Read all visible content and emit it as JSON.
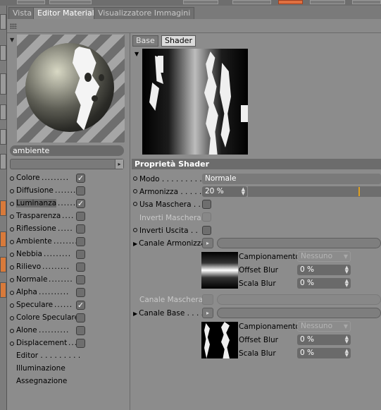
{
  "tabs": [
    {
      "label": "Vista"
    },
    {
      "label": "Editor Materiale"
    },
    {
      "label": "Visualizzatore Immagini"
    }
  ],
  "material": {
    "name": "ambiente"
  },
  "channels": [
    {
      "label": "Colore",
      "dots": ".........",
      "checked": true
    },
    {
      "label": "Diffusione",
      "dots": ".......",
      "checked": false
    },
    {
      "label": "Luminanza",
      "dots": "......",
      "checked": true
    },
    {
      "label": "Trasparenza",
      "dots": "....",
      "checked": false
    },
    {
      "label": "Riflessione",
      "dots": ".....",
      "checked": false
    },
    {
      "label": "Ambiente",
      "dots": "........",
      "checked": false
    },
    {
      "label": "Nebbia",
      "dots": ".........",
      "checked": false
    },
    {
      "label": "Rilievo",
      "dots": ".........",
      "checked": false
    },
    {
      "label": "Normale",
      "dots": "........",
      "checked": false
    },
    {
      "label": "Alpha",
      "dots": "..........",
      "checked": false
    },
    {
      "label": "Speculare",
      "dots": "......",
      "checked": true
    },
    {
      "label": "Colore Speculare",
      "dots": "",
      "checked": false
    },
    {
      "label": "Alone",
      "dots": "..........",
      "checked": false
    },
    {
      "label": "Displacement",
      "dots": "....",
      "checked": false
    }
  ],
  "extra_items": [
    {
      "label": "Editor . . . . . . . . ."
    },
    {
      "label": "Illuminazione"
    },
    {
      "label": "Assegnazione"
    }
  ],
  "subtabs": {
    "base": "Base",
    "shader": "Shader"
  },
  "properties": {
    "header": "Proprietà Shader",
    "modo_label": "Modo",
    "modo_dots": ". . . . . . . . . . .",
    "modo_value": "Normale",
    "armonizza_label": "Armonizza",
    "armonizza_dots": ". . . . . .",
    "armonizza_value": "20 %",
    "armonizza_fraction": 0.2,
    "usa_maschera_label": "Usa Maschera . .",
    "inverti_maschera_label": "Inverti Maschera",
    "inverti_uscita_label": "Inverti Uscita . .",
    "canale_armonizza_label": "Canale Armonizza",
    "canale_maschera_label": "Canale Maschera",
    "canale_base_label": "Canale Base . . . .",
    "campionamento_label": "Campionamento",
    "campionamento_value": "Nessuno",
    "offset_blur_label": "Offset Blur",
    "offset_blur_value": "0 %",
    "scala_blur_label": "Scala Blur",
    "scala_blur_value": "0 %"
  },
  "icons": {
    "collapse": "triangle-down-icon",
    "expand": "triangle-right-icon",
    "link": "arrow-right-icon",
    "stepper": "stepper-icon",
    "check": "checkmark-icon"
  },
  "colors": {
    "panel": "#8c8c8c",
    "header": "#6c6c6c",
    "accent": "#e0a020",
    "toolbar_orange": "#d97a3a"
  }
}
